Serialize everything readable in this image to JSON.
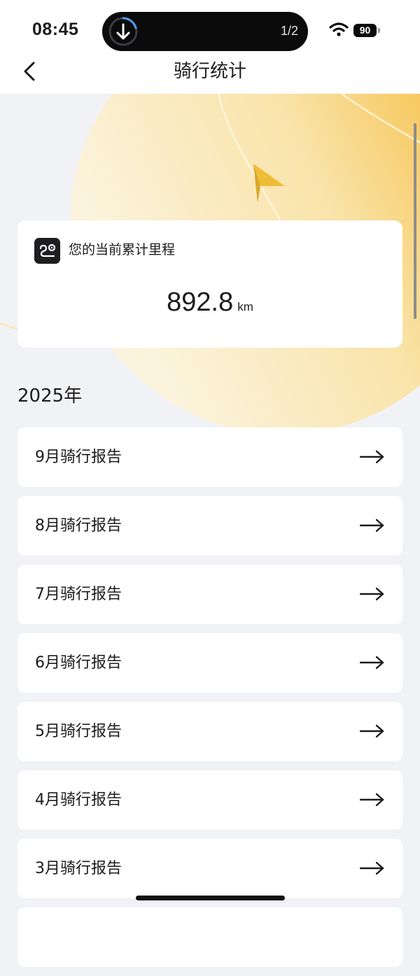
{
  "status_bar": {
    "time": "08:45",
    "island_counter": "1/2",
    "battery_level": "90"
  },
  "nav": {
    "title": "骑行统计"
  },
  "mileage": {
    "label": "您的当前累计里程",
    "value": "892.8",
    "unit": "km"
  },
  "year": "2025年",
  "reports": [
    {
      "label": "9月骑行报告"
    },
    {
      "label": "8月骑行报告"
    },
    {
      "label": "7月骑行报告"
    },
    {
      "label": "6月骑行报告"
    },
    {
      "label": "5月骑行报告"
    },
    {
      "label": "4月骑行报告"
    },
    {
      "label": "3月骑行报告"
    }
  ],
  "colors": {
    "accent_gold": "#f7b731",
    "background": "#f1f2f6",
    "card": "#ffffff",
    "text": "#1c1c1e"
  },
  "icons": {
    "back": "chevron-left-icon",
    "download": "download-arrow-icon",
    "mileage": "route-icon",
    "report_arrow": "arrow-right-icon"
  }
}
